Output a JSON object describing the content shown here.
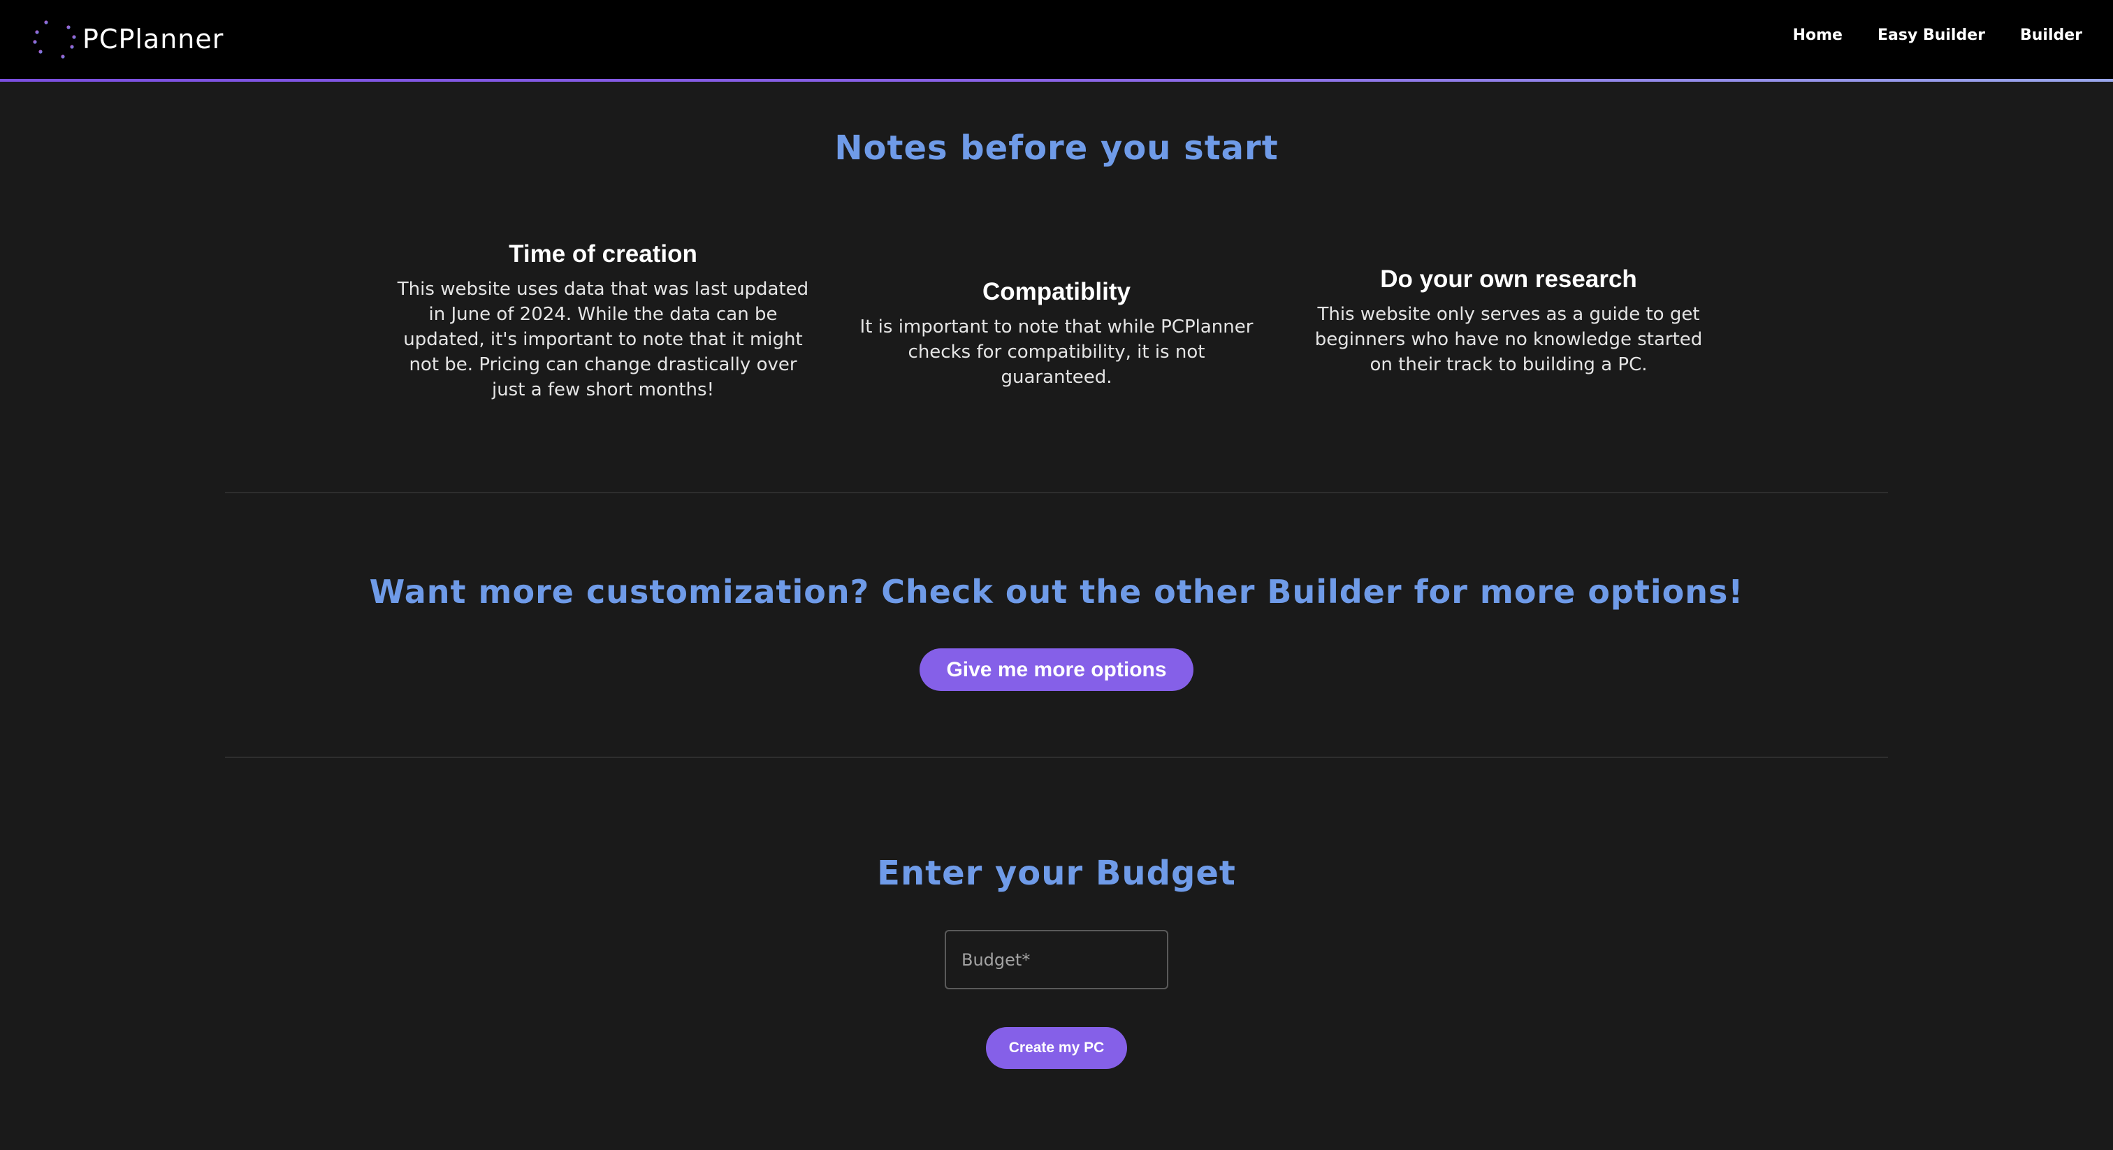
{
  "header": {
    "brand": "PCPlanner",
    "nav": [
      "Home",
      "Easy Builder",
      "Builder"
    ]
  },
  "notes": {
    "title": "Notes before you start",
    "items": [
      {
        "heading": "Time of creation",
        "text": "This website uses data that was last updated in June of 2024. While the data can be updated, it's important to note that it might not be. Pricing can change drastically over just a few short months!"
      },
      {
        "heading": "Compatiblity",
        "text": "It is important to note that while PCPlanner checks for compatibility, it is not guaranteed."
      },
      {
        "heading": "Do your own research",
        "text": "This website only serves as a guide to get beginners who have no knowledge started on their track to building a PC."
      }
    ]
  },
  "customization": {
    "title": "Want more customization? Check out the other Builder for more options!",
    "button_label": "Give me more options"
  },
  "budget": {
    "title": "Enter your Budget",
    "placeholder": "Budget*",
    "value": "",
    "button_label": "Create my PC"
  },
  "colors": {
    "accent_purple": "#8560e8",
    "heading_blue": "#6f9be8",
    "background": "#1a1a1a",
    "navbar": "#000000"
  },
  "icons": {
    "brand_logo": "circuit-globe-icon"
  }
}
